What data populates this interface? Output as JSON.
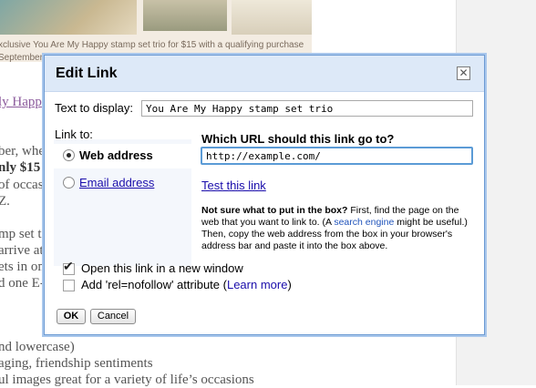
{
  "background": {
    "promo_line1": "xclusive You Are My Happy stamp set trio for $15 with a qualifying purchase",
    "promo_line2": "September",
    "fragments": [
      "ly Happ",
      "ber, whe",
      "nly $15",
      "of occas",
      "Z.",
      "mp set t",
      "arrive at",
      "ets in on",
      "d one E-",
      "nd lowercase)",
      "aging, friendship sentiments",
      "ul images great for a variety of life’s occasions"
    ]
  },
  "dialog": {
    "title": "Edit Link",
    "close_icon": "close-icon",
    "text_to_display_label": "Text to display:",
    "text_to_display_value": "You Are My Happy stamp set trio",
    "link_to_label": "Link to:",
    "options": [
      {
        "label": "Web address",
        "selected": true
      },
      {
        "label": "Email address",
        "selected": false
      }
    ],
    "url_question": "Which URL should this link go to?",
    "url_value": "http://example.com/",
    "test_link": "Test this link",
    "help": {
      "bold": "Not sure what to put in the box?",
      "part1": " First, find the page on the web that you want to link to. (A ",
      "link": "search engine",
      "part2": " might be useful.) Then, copy the web address from the box in your browser's address bar and paste it into the box above."
    },
    "new_window": {
      "label": "Open this link in a new window",
      "checked": true
    },
    "nofollow": {
      "label": "Add 'rel=nofollow' attribute (",
      "link": "Learn more",
      "suffix": ")",
      "checked": false
    },
    "ok_label": "OK",
    "cancel_label": "Cancel"
  }
}
